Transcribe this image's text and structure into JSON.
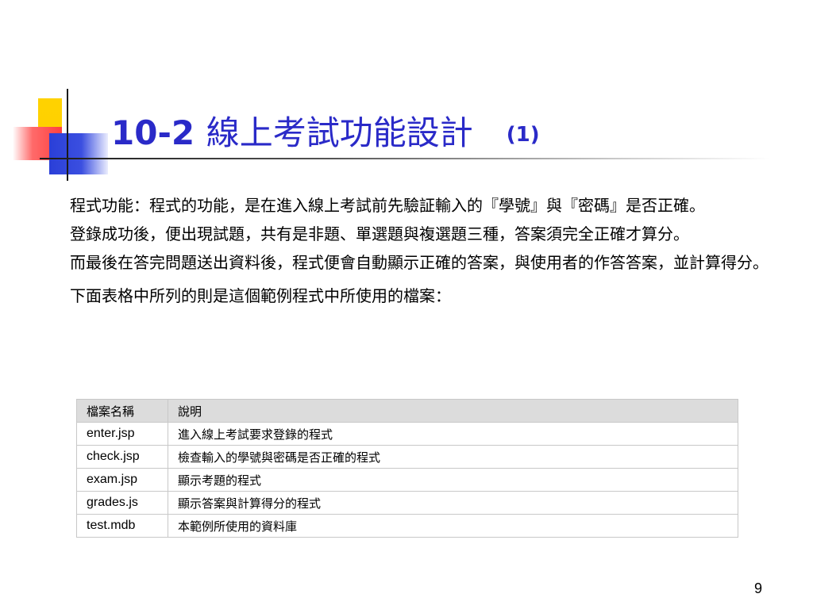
{
  "title": {
    "prefix": "10-2 ",
    "main": "線上考試功能設計",
    "suffix": "(1)"
  },
  "body": {
    "paragraph1_term": "程式功能：",
    "paragraph1_text": "程式的功能，是在進入線上考試前先驗証輸入的『學號』與『密碼』是否正確。",
    "paragraph2": "登錄成功後，便出現試題，共有是非題、單選題與複選題三種，答案須完全正確才算分。",
    "paragraph3": "而最後在答完問題送出資料後，程式便會自動顯示正確的答案，與使用者的作答答案，並計算得分。",
    "table_intro": "下面表格中所列的則是這個範例程式中所使用的檔案："
  },
  "table": {
    "headers": [
      "檔案名稱",
      "說明"
    ],
    "rows": [
      {
        "file": "enter.jsp",
        "desc": "進入線上考試要求登錄的程式"
      },
      {
        "file": "check.jsp",
        "desc": "檢查輸入的學號與密碼是否正確的程式"
      },
      {
        "file": "exam.jsp",
        "desc": "顯示考題的程式"
      },
      {
        "file": "grades.js",
        "desc": "顯示答案與計算得分的程式"
      },
      {
        "file": "test.mdb",
        "desc": "本範例所使用的資料庫"
      }
    ]
  },
  "page_number": "9",
  "colors": {
    "title": "#2a2ac8",
    "deco_yellow": "#ffd200",
    "deco_red": "#ff4040",
    "deco_blue": "#2a3fd8",
    "table_header_bg": "#dcdcdc"
  }
}
